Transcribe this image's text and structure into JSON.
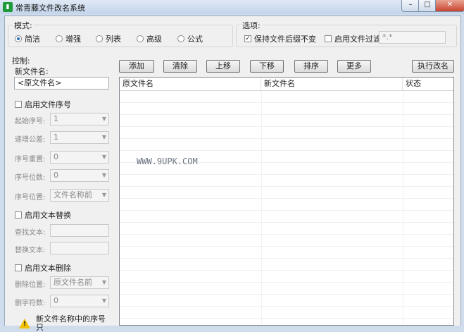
{
  "window": {
    "title": "常青藤文件改名系统",
    "min": "–",
    "max": "□",
    "close": "✕"
  },
  "mode": {
    "title": "模式:",
    "options": [
      "简洁",
      "增强",
      "列表",
      "高级",
      "公式"
    ],
    "selected": "简洁"
  },
  "options": {
    "title": "选项:",
    "keep_ext": {
      "label": "保持文件后缀不变",
      "checked": true,
      "mark": "✓"
    },
    "filter": {
      "label": "启用文件过滤",
      "checked": false,
      "value": "*.*"
    }
  },
  "control": {
    "title": "控制:",
    "new_name_label": "新文件名:",
    "new_name_value": "<原文件名>",
    "seq": {
      "label": "启用文件序号",
      "start_label": "起始序号:",
      "start_value": "1",
      "step_label": "递增公差:",
      "step_value": "1",
      "reset_label": "序号重置:",
      "reset_value": "0",
      "digits_label": "序号位数:",
      "digits_value": "0",
      "pos_label": "序号位置:",
      "pos_value": "文件名称前"
    },
    "replace": {
      "label": "启用文本替换",
      "find_label": "查找文本:",
      "replace_label": "替换文本:"
    },
    "delete": {
      "label": "启用文本删除",
      "pos_label": "删除位置:",
      "pos_value": "原文件名前",
      "count_label": "删字符数:",
      "count_value": "0"
    },
    "note": "新文件名称中的序号只"
  },
  "toolbar": {
    "add": "添加",
    "clear": "清除",
    "up": "上移",
    "down": "下移",
    "sort": "排序",
    "more": "更多",
    "execute": "执行改名"
  },
  "list": {
    "columns": [
      "原文件名",
      "新文件名",
      "状态"
    ],
    "watermark": "WWW.9UPK.COM"
  }
}
